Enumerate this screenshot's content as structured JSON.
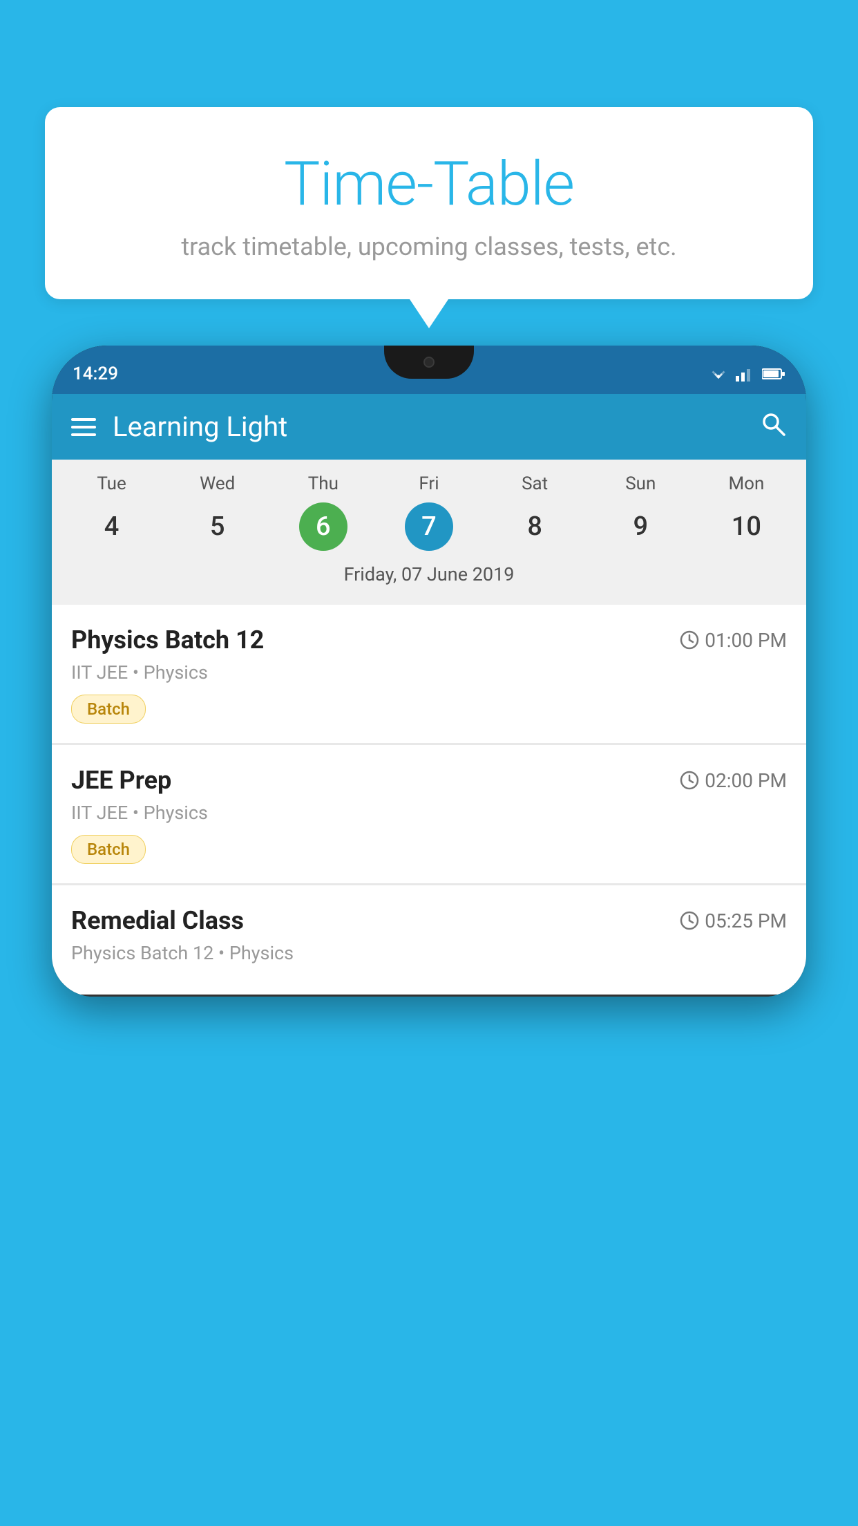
{
  "background_color": "#29b6e8",
  "bubble": {
    "title": "Time-Table",
    "subtitle": "track timetable, upcoming classes, tests, etc."
  },
  "phone": {
    "status_bar": {
      "time": "14:29"
    },
    "app_bar": {
      "title": "Learning Light"
    },
    "calendar": {
      "days": [
        {
          "label": "Tue",
          "number": "4",
          "state": "normal"
        },
        {
          "label": "Wed",
          "number": "5",
          "state": "normal"
        },
        {
          "label": "Thu",
          "number": "6",
          "state": "today"
        },
        {
          "label": "Fri",
          "number": "7",
          "state": "selected"
        },
        {
          "label": "Sat",
          "number": "8",
          "state": "normal"
        },
        {
          "label": "Sun",
          "number": "9",
          "state": "normal"
        },
        {
          "label": "Mon",
          "number": "10",
          "state": "normal"
        }
      ],
      "selected_date_label": "Friday, 07 June 2019"
    },
    "classes": [
      {
        "name": "Physics Batch 12",
        "time": "01:00 PM",
        "subtitle": "IIT JEE • Physics",
        "badge": "Batch"
      },
      {
        "name": "JEE Prep",
        "time": "02:00 PM",
        "subtitle": "IIT JEE • Physics",
        "badge": "Batch"
      },
      {
        "name": "Remedial Class",
        "time": "05:25 PM",
        "subtitle": "Physics Batch 12 • Physics",
        "badge": ""
      }
    ]
  }
}
